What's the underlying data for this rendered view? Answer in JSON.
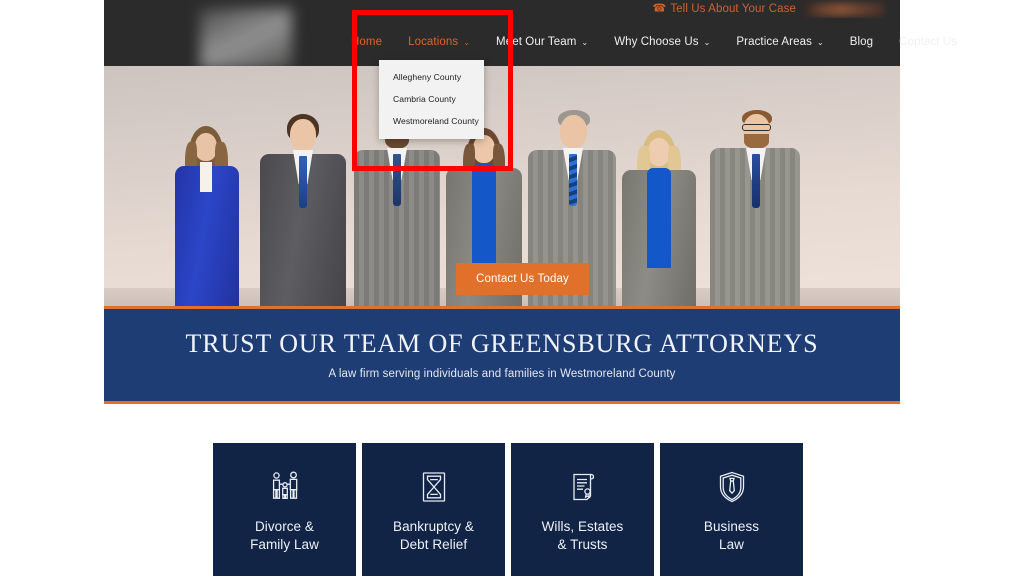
{
  "topbar": {
    "cta_text": "Tell Us About Your Case",
    "phone_icon": "phone-icon",
    "phone_number_redacted": ""
  },
  "nav": {
    "logo_alt": "law-firm-logo",
    "items": [
      {
        "label": "Home",
        "has_caret": false,
        "accent": true,
        "active": false
      },
      {
        "label": "Locations",
        "has_caret": true,
        "accent": true,
        "active": true
      },
      {
        "label": "Meet Our Team",
        "has_caret": true,
        "accent": false,
        "active": false
      },
      {
        "label": "Why Choose Us",
        "has_caret": true,
        "accent": false,
        "active": false
      },
      {
        "label": "Practice Areas",
        "has_caret": true,
        "accent": false,
        "active": false
      },
      {
        "label": "Blog",
        "has_caret": false,
        "accent": false,
        "active": false
      },
      {
        "label": "Contact Us",
        "has_caret": false,
        "accent": false,
        "active": false
      }
    ],
    "caret_glyph": "⌄"
  },
  "dropdown": {
    "parent": "Locations",
    "items": [
      {
        "label": "Allegheny County"
      },
      {
        "label": "Cambria County"
      },
      {
        "label": "Westmoreland County"
      }
    ]
  },
  "hero": {
    "image_alt": "team-of-attorneys-photo",
    "cta_label": "Contact Us Today"
  },
  "banner": {
    "heading": "TRUST OUR TEAM OF GREENSBURG ATTORNEYS",
    "subheading": "A law firm serving individuals and families in Westmoreland County"
  },
  "practice_cards": [
    {
      "icon": "family-icon",
      "line1": "Divorce &",
      "line2": "Family Law"
    },
    {
      "icon": "hourglass-icon",
      "line1": "Bankruptcy &",
      "line2": "Debt Relief"
    },
    {
      "icon": "scroll-icon",
      "line1": "Wills, Estates",
      "line2": "& Trusts"
    },
    {
      "icon": "shield-tie-icon",
      "line1": "Business",
      "line2": "Law"
    }
  ],
  "annotation": {
    "shape": "rectangle",
    "color": "#fe0000",
    "target": "locations-dropdown"
  },
  "colors": {
    "nav_bg": "#2b2b2b",
    "accent_orange": "#e0702a",
    "banner_blue": "#1e3d74",
    "card_navy": "#122446",
    "annotation_red": "#fe0000"
  }
}
